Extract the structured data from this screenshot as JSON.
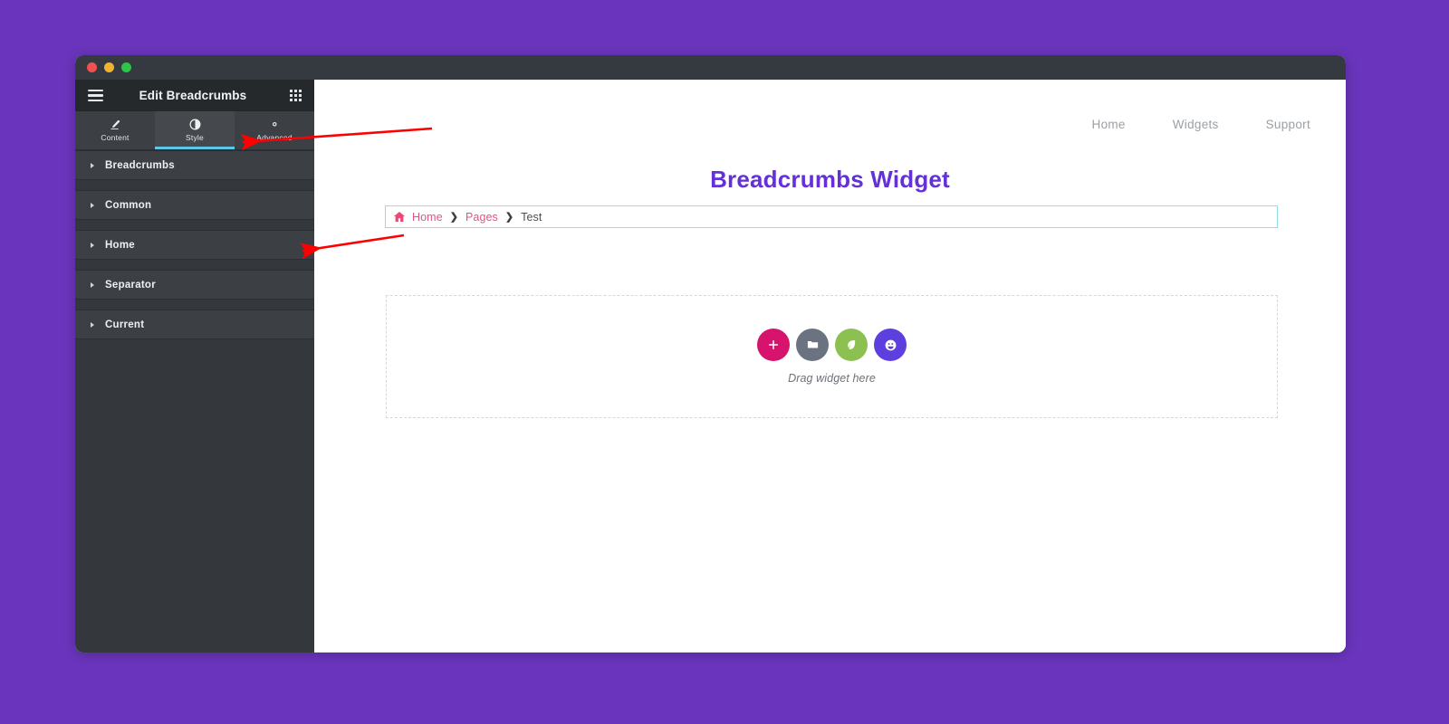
{
  "background_color": "#6a35bc",
  "window": {
    "traffic_lights": [
      {
        "name": "close",
        "color": "#f05252"
      },
      {
        "name": "minimize",
        "color": "#f2b32c"
      },
      {
        "name": "zoom",
        "color": "#2fc44a"
      }
    ]
  },
  "panel": {
    "title": "Edit Breadcrumbs",
    "menu_icon": "hamburger-icon",
    "grid_icon": "widgets-grid-icon",
    "collapse_icon": "‹",
    "tabs": [
      {
        "label": "Content",
        "icon": "pencil-icon",
        "active": false
      },
      {
        "label": "Style",
        "icon": "contrast-circle-icon",
        "active": true
      },
      {
        "label": "Advanced",
        "icon": "gear-icon",
        "active": false
      }
    ],
    "active_tab": "Style",
    "sections": [
      {
        "label": "Breadcrumbs",
        "expanded": false
      },
      {
        "label": "Common",
        "expanded": false
      },
      {
        "label": "Home",
        "expanded": false
      },
      {
        "label": "Separator",
        "expanded": false
      },
      {
        "label": "Current",
        "expanded": false
      }
    ]
  },
  "preview": {
    "nav": [
      {
        "label": "Home"
      },
      {
        "label": "Widgets"
      },
      {
        "label": "Support"
      }
    ],
    "page_title": "Breadcrumbs Widget",
    "page_title_color": "#6430d8",
    "breadcrumb": {
      "home_icon": "home-icon",
      "items": [
        {
          "label": "Home",
          "type": "link"
        },
        {
          "label": "Pages",
          "type": "link"
        },
        {
          "label": "Test",
          "type": "current"
        }
      ],
      "separator": "❯",
      "link_color": "#e2557e",
      "current_color": "#4a4f55",
      "selection_outline_color": "#8fdcf0"
    },
    "dropzone": {
      "label": "Drag widget here",
      "buttons": [
        {
          "name": "add-widget-button",
          "icon": "plus-icon",
          "color": "#d6136d"
        },
        {
          "name": "add-folder-button",
          "icon": "folder-icon",
          "color": "#6b7280"
        },
        {
          "name": "add-template-button",
          "icon": "leaf-icon",
          "color": "#8cc152"
        },
        {
          "name": "add-global-button",
          "icon": "smiley-icon",
          "color": "#5d3fe0"
        }
      ]
    }
  },
  "annotations": [
    {
      "name": "arrow-to-style-advanced-tabs",
      "color": "#ff0000"
    },
    {
      "name": "arrow-to-home-section",
      "color": "#ff0000"
    }
  ]
}
